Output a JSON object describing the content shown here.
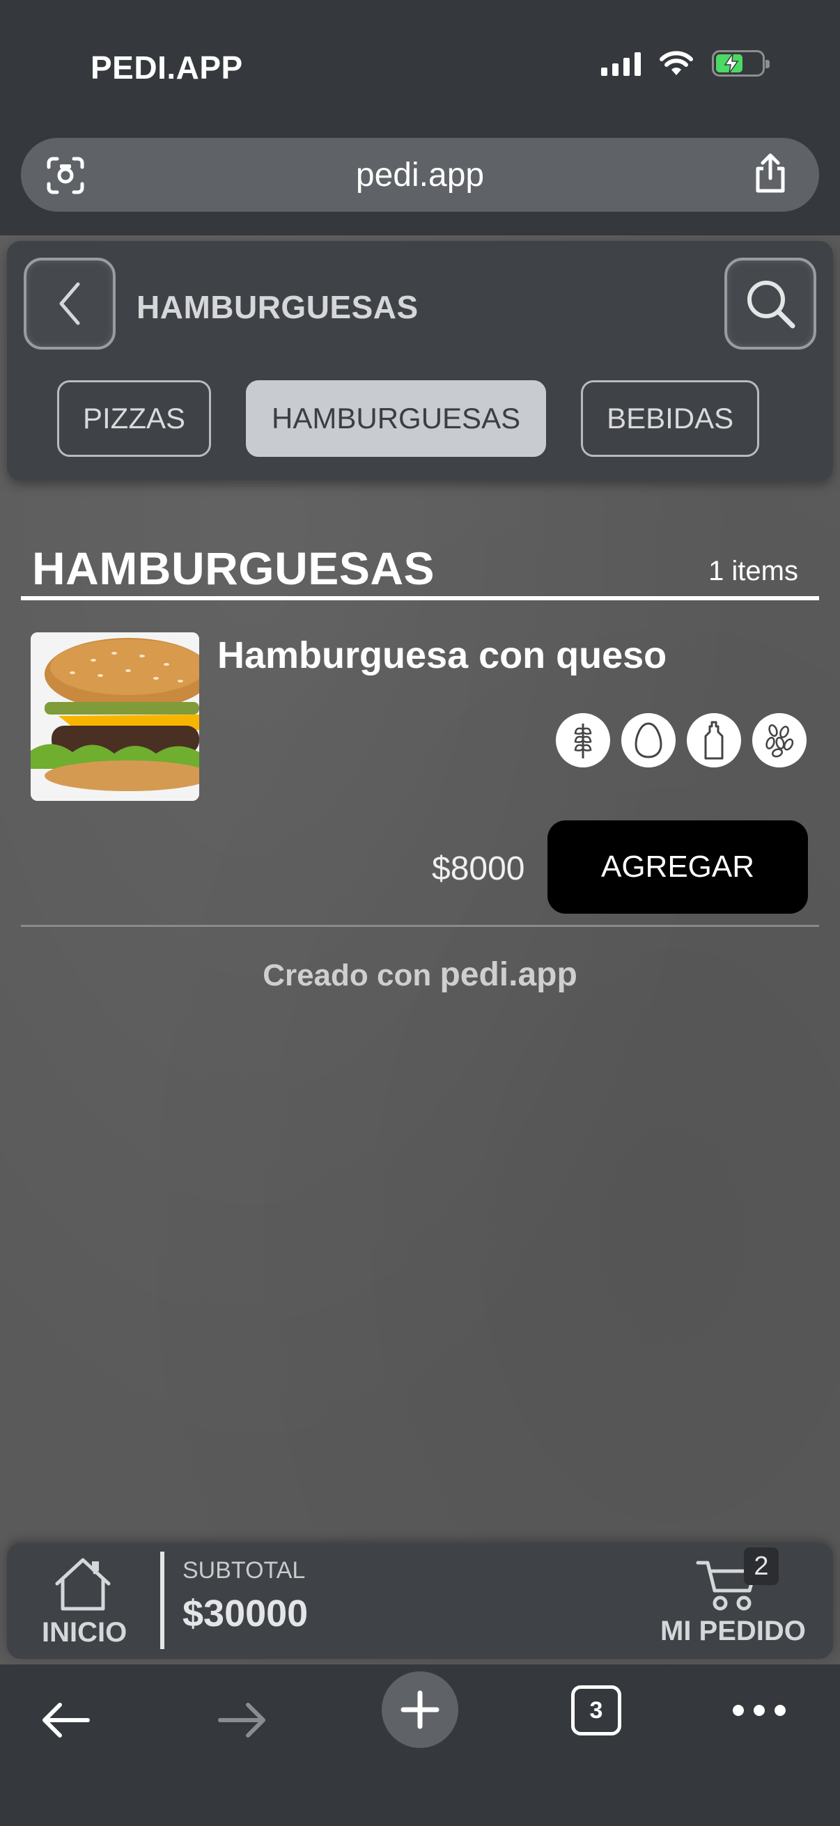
{
  "status_bar": {
    "title": "PEDI.APP"
  },
  "browser": {
    "url": "pedi.app",
    "tabs_count": "3"
  },
  "nav": {
    "title": "HAMBURGUESAS",
    "tabs": [
      {
        "label": "PIZZAS",
        "active": false
      },
      {
        "label": "HAMBURGUESAS",
        "active": true
      },
      {
        "label": "BEBIDAS",
        "active": false
      }
    ]
  },
  "section": {
    "title": "HAMBURGUESAS",
    "count": "1 items"
  },
  "product": {
    "name": "Hamburguesa con queso",
    "price": "$8000",
    "add_label": "AGREGAR",
    "allergens": [
      "gluten-icon",
      "egg-icon",
      "sauce-bottle-icon",
      "sesame-icon"
    ]
  },
  "footer": {
    "prefix": "Creado con",
    "brand": "pedi.app"
  },
  "order_bar": {
    "home_label": "INICIO",
    "subtotal_label": "SUBTOTAL",
    "subtotal_value": "$30000",
    "cart_count": "2",
    "cart_label": "MI PEDIDO"
  },
  "colors": {
    "chrome": "#35383c",
    "card": "#3f4246",
    "active_tab": "#c8cbd0",
    "add_button": "#000000",
    "battery": "#4cd964"
  }
}
